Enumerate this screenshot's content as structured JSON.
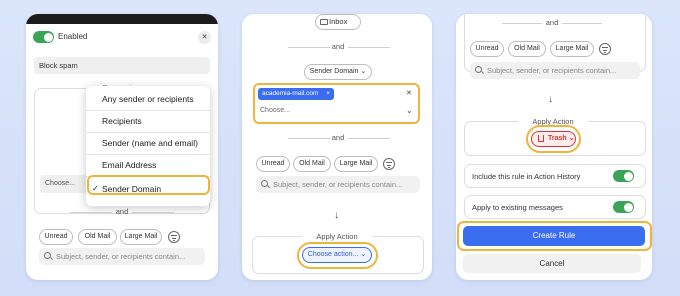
{
  "panel1": {
    "enabled_label": "Enabled",
    "close_glyph": "✕",
    "rule_name": "Block spam",
    "expression_label": "Expression",
    "choose_placeholder": "Choose...",
    "and_label": "and",
    "dropdown_items": [
      "Any sender or recipients",
      "Recipients",
      "Sender (name and email)",
      "Email Address",
      "Sender Domain"
    ],
    "selected_index": 4,
    "check_glyph": "✓",
    "filter_pills": [
      "Unread",
      "Old Mail",
      "Large Mail"
    ],
    "search_placeholder": "Subject, sender, or recipients contain..."
  },
  "panel2": {
    "inbox_label": "Inbox",
    "and_label": "and",
    "sender_domain_label": "Sender Domain",
    "domain_token": "academia-mail.com",
    "token_remove": "×",
    "clear_glyph": "✕",
    "choose_placeholder": "Choose...",
    "and_label_2": "and",
    "filter_pills": [
      "Unread",
      "Old Mail",
      "Large Mail"
    ],
    "search_placeholder": "Subject, sender, or recipients contain...",
    "apply_action_label": "Apply Action",
    "choose_action_label": "Choose action..."
  },
  "panel3": {
    "and_label": "and",
    "filter_pills": [
      "Unread",
      "Old Mail",
      "Large Mail"
    ],
    "search_placeholder": "Subject, sender, or recipients contain...",
    "apply_action_label": "Apply Action",
    "trash_label": "Trash",
    "history_label": "Include this rule in Action History",
    "existing_label": "Apply to existing messages",
    "create_label": "Create Rule",
    "cancel_label": "Cancel"
  },
  "colors": {
    "accent": "#3b6df0",
    "toggle_on": "#3aa557",
    "highlight": "#f1b43a",
    "trash": "#d8333a"
  }
}
